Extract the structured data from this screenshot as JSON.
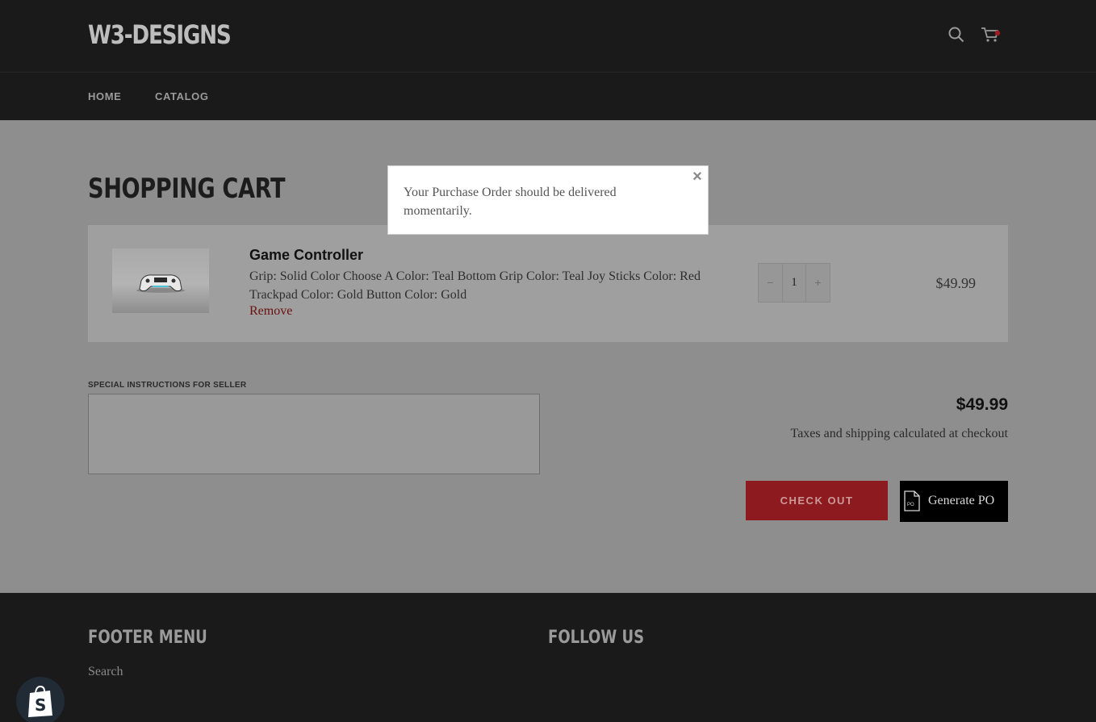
{
  "header": {
    "logo": "W3-DESIGNS",
    "search_icon": "search-icon",
    "cart_icon": "cart-icon",
    "nav": [
      {
        "label": "HOME"
      },
      {
        "label": "CATALOG"
      }
    ]
  },
  "main": {
    "page_title": "SHOPPING CART",
    "cart_item": {
      "title": "Game Controller",
      "variant": "Grip: Solid Color Choose A Color: Teal Bottom Grip Color: Teal Joy Sticks Color: Red Trackpad Color: Gold Button Color: Gold",
      "remove_label": "Remove",
      "quantity": "1",
      "minus_label": "−",
      "plus_label": "+",
      "price": "$49.99"
    },
    "instructions_label": "SPECIAL INSTRUCTIONS FOR SELLER",
    "instructions_value": "",
    "subtotal": "$49.99",
    "tax_note": "Taxes and shipping calculated at checkout",
    "checkout_label": "CHECK OUT",
    "po_label": "Generate PO"
  },
  "modal": {
    "message": "Your Purchase Order should be delivered momentarily.",
    "close_label": "×"
  },
  "footer": {
    "menu_heading": "FOOTER MENU",
    "follow_heading": "FOLLOW US",
    "links": [
      {
        "label": "Search"
      }
    ]
  },
  "colors": {
    "accent": "#8c1a1f",
    "header_bg": "#1a1a1a",
    "overlay_bg": "#8e8e8e"
  }
}
